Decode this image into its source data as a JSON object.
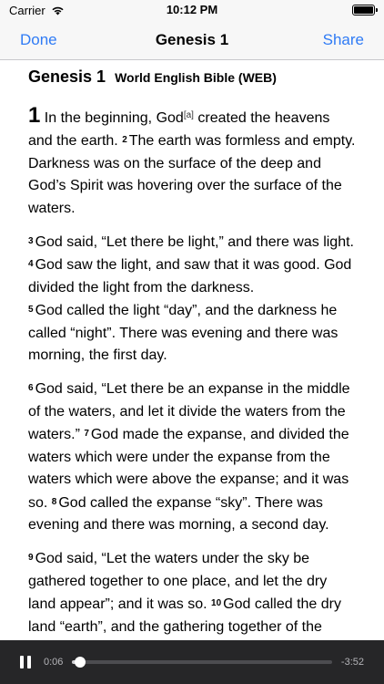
{
  "status_bar": {
    "carrier": "Carrier",
    "time": "10:12 PM",
    "battery_level": 1.0
  },
  "nav": {
    "left": "Done",
    "title": "Genesis 1",
    "right": "Share"
  },
  "chapter": {
    "title": "Genesis 1",
    "translation": "World English Bible (WEB)"
  },
  "paragraphs": [
    {
      "chapter_number": "1",
      "text_a": " In the beginning, God",
      "footnote": "[a]",
      "text_b": " created the heavens and the earth. ",
      "v2": "2",
      "v2_text": "The earth was formless and empty. Darkness was on the surface of the deep and God’s Spirit was hovering over the surface of the waters."
    },
    {
      "v3": "3",
      "v3_text": "God said, “Let there be light,” and there was light. ",
      "v4": "4",
      "v4_text": "God saw the light, and saw that it was good. God divided the light from the darkness."
    },
    {
      "v5": "5",
      "v5_text": "God called the light “day”, and the darkness he called “night”. There was evening and there was morning, the first day."
    },
    {
      "v6": "6",
      "v6_text": "God said, “Let there be an expanse in the middle of the waters, and let it divide the waters from the waters.” ",
      "v7": "7",
      "v7_text": "God made the expanse, and divided the waters which were under the expanse from the waters which were above the expanse; and it was so. ",
      "v8": "8",
      "v8_text": "God called the expanse “sky”. There was evening and there was morning, a second day."
    },
    {
      "v9": "9",
      "v9_text": "God said, “Let the waters under the sky be gathered together to one place, and let the dry land appear”; and it was so. ",
      "v10": "10",
      "v10_text": "God called the dry land “earth”, and the gathering together of the"
    }
  ],
  "player": {
    "elapsed": "0:06",
    "remaining": "-3:52",
    "progress": 0.03
  }
}
